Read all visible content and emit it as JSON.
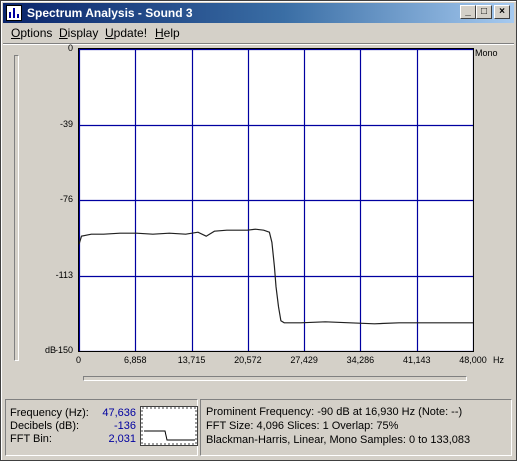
{
  "window": {
    "title": "Spectrum Analysis - Sound 3",
    "controls": {
      "minimize": "_",
      "maximize": "□",
      "close": "×"
    }
  },
  "menu": {
    "items": [
      {
        "label": "Options",
        "mnemonic": "O"
      },
      {
        "label": "Display",
        "mnemonic": "D"
      },
      {
        "label": "Update!",
        "mnemonic": "U"
      },
      {
        "label": "Help",
        "mnemonic": "H"
      }
    ]
  },
  "graph": {
    "channel_label": "Mono",
    "y_unit": "dB",
    "x_unit": "Hz",
    "y_ticks": [
      "0",
      "-39",
      "-76",
      "-113",
      "-150"
    ],
    "x_ticks": [
      "0",
      "6,858",
      "13,715",
      "20,572",
      "27,429",
      "34,286",
      "41,143",
      "48,000"
    ],
    "grid_color": "#0000a0",
    "trace_color": "#202020"
  },
  "chart_data": {
    "type": "line",
    "xlabel": "Hz",
    "ylabel": "dB",
    "xlim": [
      0,
      48000
    ],
    "ylim": [
      -150,
      0
    ],
    "grid": true,
    "series": [
      {
        "x": [
          0,
          300,
          1500,
          3000,
          5000,
          7000,
          9000,
          11000,
          13000,
          14500,
          15500,
          16500,
          18000,
          19500,
          20500,
          21500,
          22500,
          23200,
          23500,
          23800,
          24000,
          24300,
          24600,
          25000,
          27000,
          30000,
          33000,
          36000,
          39000,
          42000,
          45000,
          48000
        ],
        "y": [
          -97,
          -93,
          -92,
          -92,
          -91.5,
          -91.5,
          -92,
          -91.5,
          -92,
          -91,
          -93,
          -90.5,
          -90,
          -90,
          -90,
          -89.5,
          -90,
          -91,
          -96,
          -108,
          -118,
          -128,
          -135,
          -136,
          -136,
          -135.5,
          -136,
          -136.5,
          -136,
          -136,
          -136,
          -136
        ]
      }
    ]
  },
  "status": {
    "frequency": {
      "label": "Frequency (Hz):",
      "value": "47,636"
    },
    "decibels": {
      "label": "Decibels (dB):",
      "value": "-136"
    },
    "fft_bin": {
      "label": "FFT Bin:",
      "value": "2,031"
    },
    "info": {
      "line1": "Prominent Frequency: -90 dB at 16,930 Hz (Note: --)",
      "line2": "FFT Size: 4,096  Slices: 1  Overlap: 75%",
      "line3": "Blackman-Harris, Linear, Mono  Samples: 0 to 133,083"
    }
  }
}
